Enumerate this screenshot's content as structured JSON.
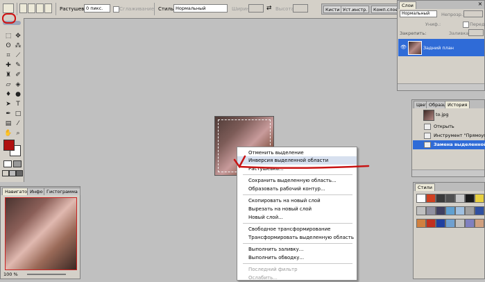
{
  "options_bar": {
    "feather_label": "Растушевка:",
    "feather_value": "0 пикс.",
    "antialias_label": "Сглаживание",
    "style_label": "Стиль:",
    "style_value": "Нормальный",
    "width_label": "Ширина:",
    "height_label": "Высота:",
    "well_tabs": [
      "Кисти",
      "Уст.инстр.",
      "Комп.слоев"
    ]
  },
  "context_menu": {
    "items": [
      {
        "label": "Отменить выделение",
        "state": "normal"
      },
      {
        "label": "Инверсия выделенной области",
        "state": "highlighted"
      },
      {
        "label": "Растушевка...",
        "state": "normal"
      },
      {
        "label": "Сохранить выделенную область...",
        "state": "normal"
      },
      {
        "label": "Образовать рабочий контур...",
        "state": "normal"
      },
      {
        "label": "Скопировать на новый слой",
        "state": "normal"
      },
      {
        "label": "Вырезать на новый слой",
        "state": "normal"
      },
      {
        "label": "Новый слой...",
        "state": "normal"
      },
      {
        "label": "Свободное трансформирование",
        "state": "normal"
      },
      {
        "label": "Трансформировать выделенную область",
        "state": "normal"
      },
      {
        "label": "Выполнить заливку...",
        "state": "normal"
      },
      {
        "label": "Выполнить обводку...",
        "state": "normal"
      },
      {
        "label": "Последний фильтр",
        "state": "disabled"
      },
      {
        "label": "Ослабить...",
        "state": "disabled"
      }
    ]
  },
  "layers_panel": {
    "tab": "Слои",
    "blend_mode": "Нормальный",
    "opacity_label": "Непрозр.:",
    "lock_label": "Закрепить:",
    "fill_label": "Заливка:",
    "unify_label": "Униф.:",
    "propagate_label": "Передать",
    "layer_name": "Задний план"
  },
  "history_panel": {
    "tabs": [
      "Цвет",
      "Образцы",
      "История"
    ],
    "snapshot": "to.jpg",
    "items": [
      {
        "label": "Открыть",
        "active": false
      },
      {
        "label": "Инструмент \"Прямоугол...",
        "active": false
      },
      {
        "label": "Замена выделенной о...",
        "active": true
      }
    ]
  },
  "styles_panel": {
    "tab": "Стили",
    "swatch_colors": [
      "#ffffff",
      "#d04020",
      "#3a3a3a",
      "#505050",
      "#c8c8c8",
      "#1a1a1a",
      "#e8d040",
      "#c0c0c0",
      "#9090a0",
      "#404060",
      "#60a0d0",
      "#a0c0e0",
      "#a0a0a0",
      "#3050a0",
      "#d08040",
      "#c03020",
      "#2040a0",
      "#70a0d0",
      "#c0c0c0",
      "#8080c0",
      "#d0a080"
    ]
  },
  "navigator_panel": {
    "tabs": [
      "Навигатор",
      "Инфо",
      "Гистограмма"
    ],
    "zoom": "100 %"
  }
}
